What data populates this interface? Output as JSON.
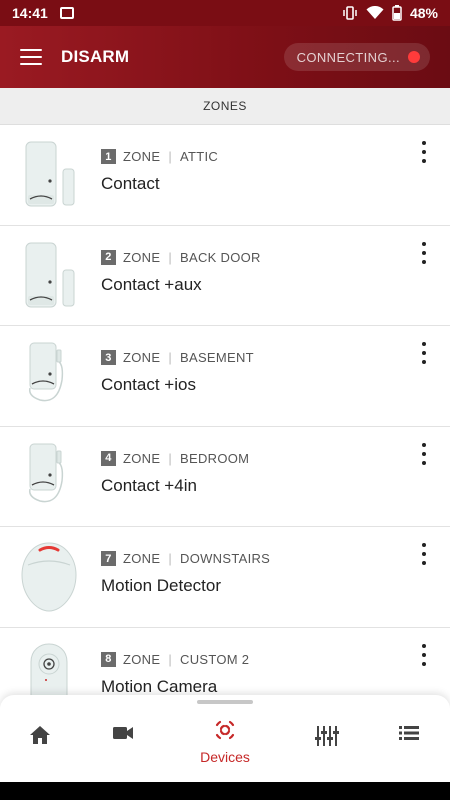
{
  "status_bar": {
    "time": "14:41",
    "battery": "48%"
  },
  "header": {
    "title": "DISARM",
    "status_text": "CONNECTING...",
    "status_dot_color": "#ff3b3b",
    "accent": "#7d0f16"
  },
  "section": {
    "title": "ZONES"
  },
  "zones": [
    {
      "number": "1",
      "label": "ZONE",
      "location": "ATTIC",
      "title": "Contact",
      "icon": "contact-sensor"
    },
    {
      "number": "2",
      "label": "ZONE",
      "location": "BACK DOOR",
      "title": "Contact +aux",
      "icon": "contact-sensor"
    },
    {
      "number": "3",
      "label": "ZONE",
      "location": "BASEMENT",
      "title": "Contact +ios",
      "icon": "wired-contact-sensor"
    },
    {
      "number": "4",
      "label": "ZONE",
      "location": "BEDROOM",
      "title": "Contact +4in",
      "icon": "wired-contact-sensor"
    },
    {
      "number": "7",
      "label": "ZONE",
      "location": "DOWNSTAIRS",
      "title": "Motion Detector",
      "icon": "motion-detector"
    },
    {
      "number": "8",
      "label": "ZONE",
      "location": "CUSTOM 2",
      "title": "Motion Camera",
      "icon": "motion-camera"
    }
  ],
  "bottom_nav": {
    "items": [
      {
        "name": "home",
        "label": ""
      },
      {
        "name": "video",
        "label": ""
      },
      {
        "name": "devices",
        "label": "Devices",
        "active": true
      },
      {
        "name": "controls",
        "label": ""
      },
      {
        "name": "list",
        "label": ""
      }
    ],
    "active_color": "#c62828"
  }
}
